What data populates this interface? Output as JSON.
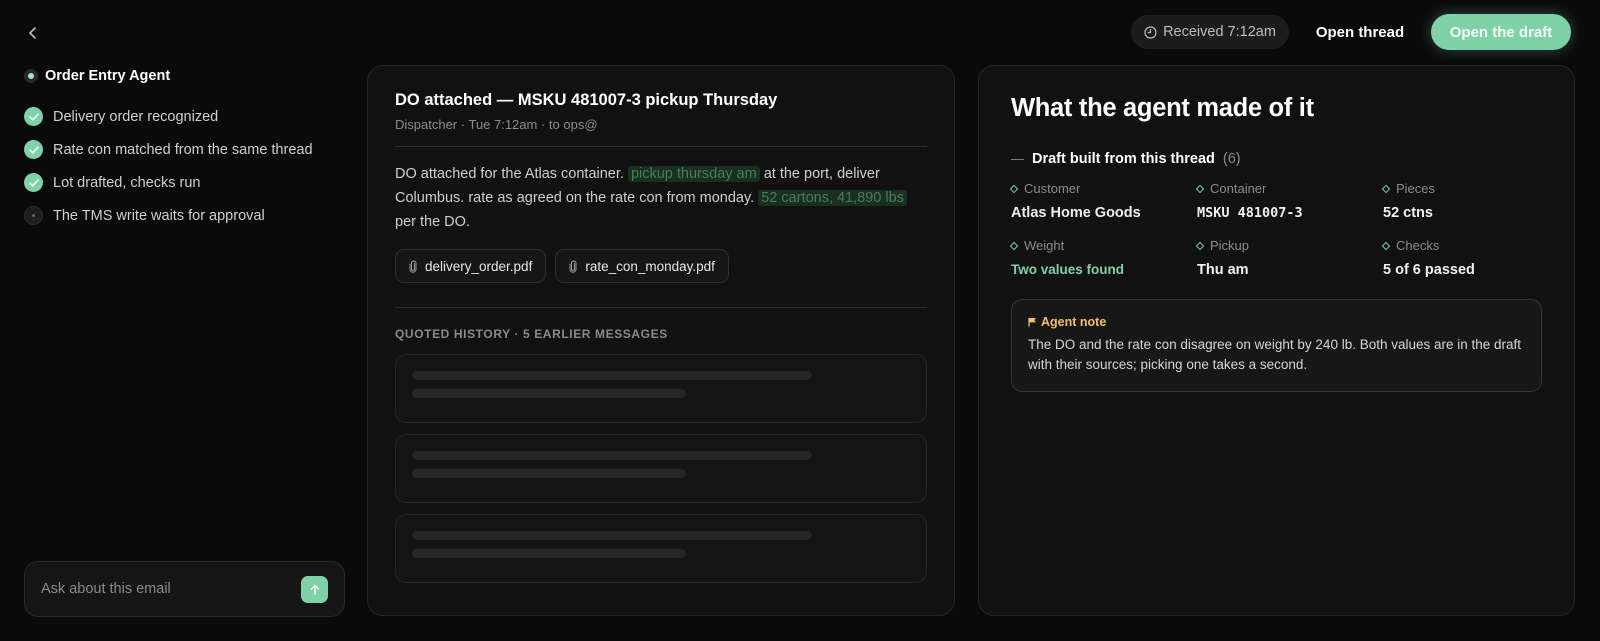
{
  "nav": {
    "back_icon": "chevron-left-icon"
  },
  "agent": {
    "title": "Order Entry Agent",
    "steps": [
      {
        "label": "Delivery order recognized",
        "status": "done"
      },
      {
        "label": "Rate con matched from the same thread",
        "status": "done"
      },
      {
        "label": "Lot drafted, checks run",
        "status": "done"
      },
      {
        "label": "The TMS write waits for approval",
        "status": "pending"
      }
    ]
  },
  "ask": {
    "placeholder": "Ask about this email",
    "send_icon": "arrow-up-icon"
  },
  "header": {
    "received": "Received 7:12am",
    "open_thread": "Open thread",
    "open_draft": "Open the draft"
  },
  "email": {
    "subject": "DO attached — MSKU 481007-3 pickup Thursday",
    "meta": "Dispatcher · Tue 7:12am · to ops@",
    "body": {
      "t1": "DO attached for the Atlas container. ",
      "h1": "pickup thursday am",
      "t2": " at the port, deliver Columbus. rate as agreed on the rate con from monday. ",
      "h2": "52 cartons, 41,890 lbs",
      "t3": " per the DO."
    },
    "attachments": [
      {
        "name": "delivery_order.pdf",
        "icon": "paperclip-icon"
      },
      {
        "name": "rate_con_monday.pdf",
        "icon": "paperclip-icon"
      }
    ],
    "quoted_label": "QUOTED HISTORY · 5 EARLIER MESSAGES",
    "quoted_count": 3
  },
  "analysis": {
    "heading": "What the agent made of it",
    "draft_label": "Draft built from this thread",
    "draft_count": "(6)",
    "fields": [
      {
        "label": "Customer",
        "value": "Atlas Home Goods",
        "style": "normal"
      },
      {
        "label": "Container",
        "value": "MSKU 481007-3",
        "style": "mono"
      },
      {
        "label": "Pieces",
        "value": "52 ctns",
        "style": "normal"
      },
      {
        "label": "Weight",
        "value": "Two values found",
        "style": "green"
      },
      {
        "label": "Pickup",
        "value": "Thu am",
        "style": "normal"
      },
      {
        "label": "Checks",
        "value": "5 of 6 passed",
        "style": "normal"
      }
    ],
    "note": {
      "title": "Agent note",
      "icon": "flag-icon",
      "text": "The DO and the rate con disagree on weight by 240 lb. Both values are in the draft with their sources; picking one takes a second."
    }
  },
  "colors": {
    "accent": "#7fd1a7",
    "note": "#eec06a",
    "background": "#0a0a0a",
    "panel": "#111111"
  }
}
